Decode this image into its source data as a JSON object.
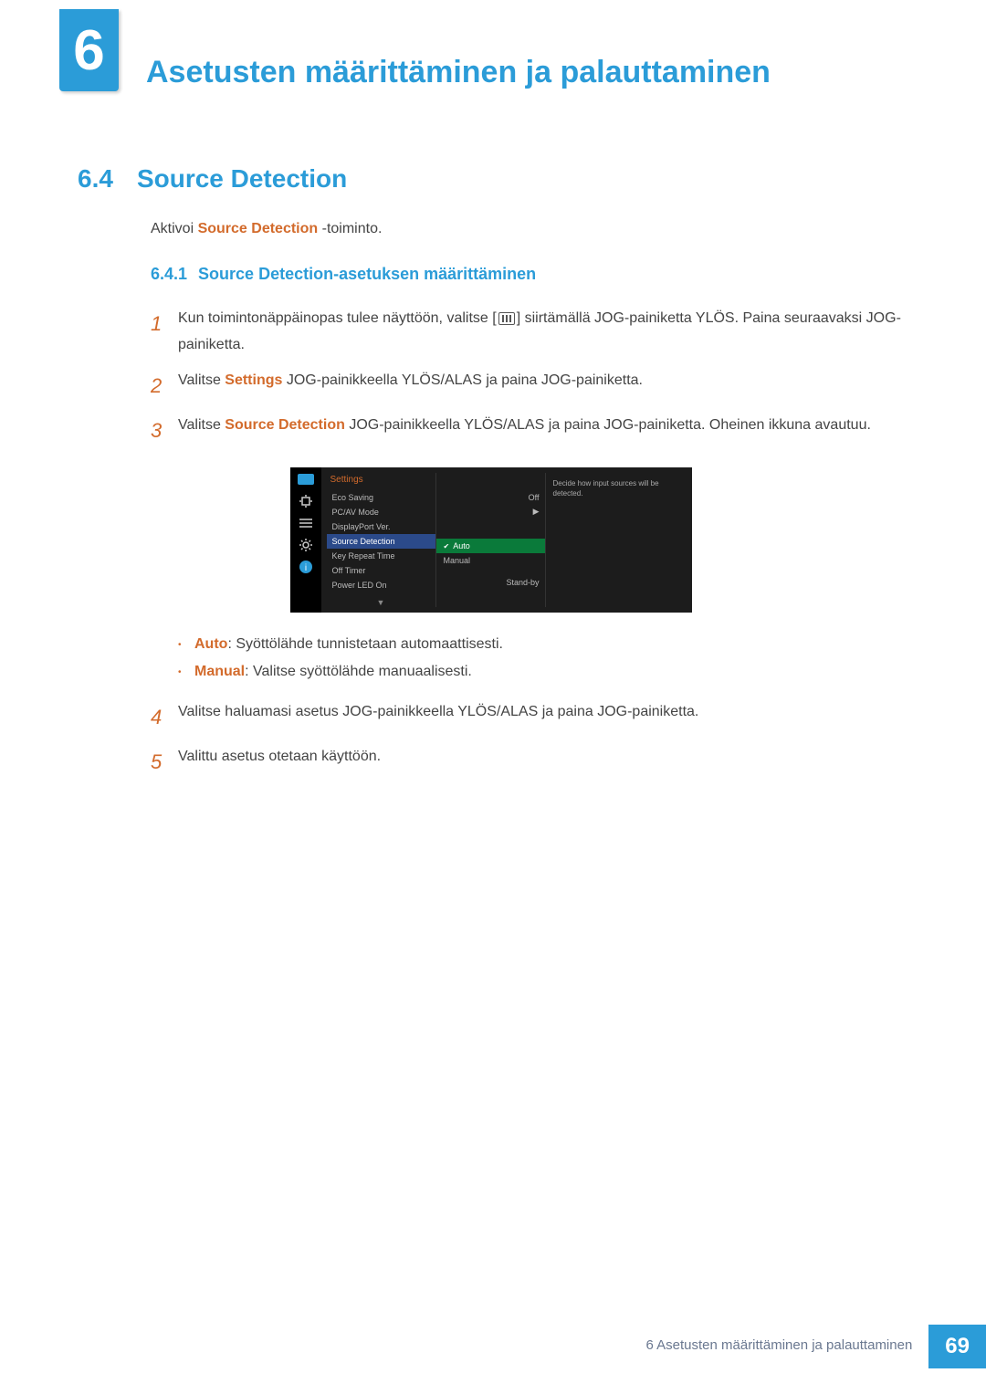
{
  "chapter": {
    "number": "6",
    "title": "Asetusten määrittäminen ja palauttaminen"
  },
  "section": {
    "number": "6.4",
    "title": "Source Detection"
  },
  "intro": {
    "prefix": "Aktivoi ",
    "highlight": "Source Detection",
    "suffix": " -toiminto."
  },
  "subsection": {
    "number": "6.4.1",
    "title": "Source Detection-asetuksen määrittäminen"
  },
  "steps": {
    "s1": {
      "num": "1",
      "pre": "Kun toimintonäppäinopas tulee näyttöön, valitse [",
      "post": "] siirtämällä JOG-painiketta YLÖS. Paina seuraavaksi JOG-painiketta."
    },
    "s2": {
      "num": "2",
      "pre": "Valitse ",
      "hl": "Settings",
      "post": " JOG-painikkeella YLÖS/ALAS ja paina JOG-painiketta."
    },
    "s3": {
      "num": "3",
      "pre": "Valitse ",
      "hl": "Source Detection",
      "post": " JOG-painikkeella YLÖS/ALAS ja paina JOG-painiketta. Oheinen ikkuna avautuu."
    },
    "s4": {
      "num": "4",
      "text": "Valitse haluamasi asetus JOG-painikkeella YLÖS/ALAS ja paina JOG-painiketta."
    },
    "s5": {
      "num": "5",
      "text": "Valittu asetus otetaan käyttöön."
    }
  },
  "osd": {
    "title": "Settings",
    "items": {
      "eco": "Eco Saving",
      "pcav": "PC/AV Mode",
      "dp": "DisplayPort Ver.",
      "src": "Source Detection",
      "key": "Key Repeat Time",
      "off": "Off Timer",
      "led": "Power LED On"
    },
    "values": {
      "eco": "Off",
      "pcav": "▶",
      "led": "Stand-by"
    },
    "options": {
      "auto": "Auto",
      "manual": "Manual"
    },
    "help": "Decide how input sources will be detected."
  },
  "bullets": {
    "auto": {
      "hl": "Auto",
      "text": ": Syöttölähde tunnistetaan automaattisesti."
    },
    "manual": {
      "hl": "Manual",
      "text": ": Valitse syöttölähde manuaalisesti."
    }
  },
  "footer": {
    "text": "6 Asetusten määrittäminen ja palauttaminen",
    "page": "69"
  }
}
